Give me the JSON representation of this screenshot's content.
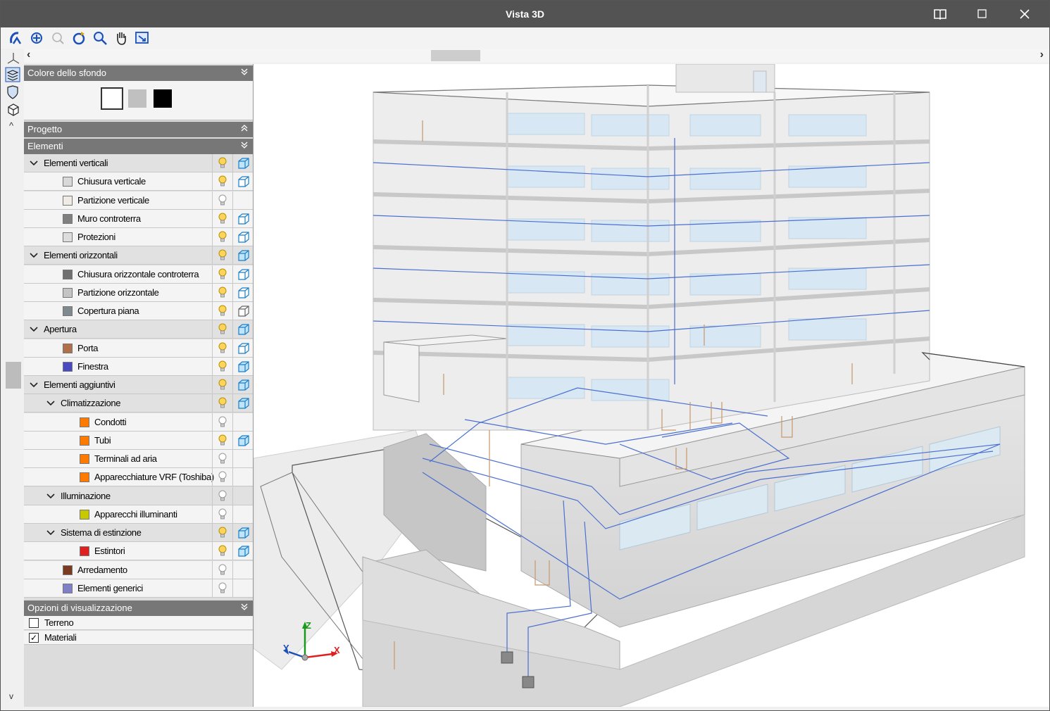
{
  "window": {
    "title": "Vista 3D",
    "book_icon": "book-icon",
    "maximize_icon": "maximize-icon",
    "close_icon": "close-icon"
  },
  "toolbar": {
    "icons": [
      "rotate-view-icon",
      "zoom-extents-icon",
      "zoom-previous-icon",
      "refresh-view-icon",
      "zoom-window-icon",
      "pan-hand-icon",
      "export-view-icon"
    ]
  },
  "scroll": {
    "left_arrow": "‹",
    "right_arrow": "›",
    "up_arrow": "^",
    "down_arrow": "v"
  },
  "background_panel": {
    "title": "Colore dello sfondo",
    "colors": [
      "#ffffff",
      "#c0c0c0",
      "#000000"
    ],
    "selected": 0
  },
  "project_panel": {
    "title": "Progetto"
  },
  "elements_panel": {
    "title": "Elementi",
    "rows": [
      {
        "label": "Elementi verticali",
        "level": 0,
        "group": true,
        "bulb": true,
        "cube": "solid"
      },
      {
        "label": "Chiusura verticale",
        "level": 1,
        "color": "#d9d9d9",
        "bulb": true,
        "cube": "wire"
      },
      {
        "label": "Partizione verticale",
        "level": 1,
        "color": "#f1ebe6",
        "bulb": false,
        "cube": "none"
      },
      {
        "label": "Muro controterra",
        "level": 1,
        "color": "#808080",
        "bulb": true,
        "cube": "wire"
      },
      {
        "label": "Protezioni",
        "level": 1,
        "color": "#dddddd",
        "bulb": true,
        "cube": "wire"
      },
      {
        "label": "Elementi orizzontali",
        "level": 0,
        "group": true,
        "bulb": true,
        "cube": "solid"
      },
      {
        "label": "Chiusura orizzontale controterra",
        "level": 1,
        "color": "#707070",
        "bulb": true,
        "cube": "wire"
      },
      {
        "label": "Partizione orizzontale",
        "level": 1,
        "color": "#c4c4c4",
        "bulb": true,
        "cube": "wire"
      },
      {
        "label": "Copertura piana",
        "level": 1,
        "color": "#808a8e",
        "bulb": true,
        "cube": "grey"
      },
      {
        "label": "Apertura",
        "level": 0,
        "group": true,
        "bulb": true,
        "cube": "solid"
      },
      {
        "label": "Porta",
        "level": 1,
        "color": "#b0704a",
        "bulb": true,
        "cube": "wire"
      },
      {
        "label": "Finestra",
        "level": 1,
        "color": "#4a4ac0",
        "bulb": true,
        "cube": "solid"
      },
      {
        "label": "Elementi aggiuntivi",
        "level": 0,
        "group": true,
        "bulb": true,
        "cube": "solid"
      },
      {
        "label": "Climatizzazione",
        "level": 1,
        "group": true,
        "bulb": true,
        "cube": "solid"
      },
      {
        "label": "Condotti",
        "level": 2,
        "color": "#ff7a00",
        "bulb": false,
        "cube": "none"
      },
      {
        "label": "Tubi",
        "level": 2,
        "color": "#ff7a00",
        "bulb": true,
        "cube": "solid"
      },
      {
        "label": "Terminali ad aria",
        "level": 2,
        "color": "#ff7a00",
        "bulb": false,
        "cube": "none"
      },
      {
        "label": "Apparecchiature VRF (Toshiba)",
        "level": 2,
        "color": "#ff7a00",
        "bulb": false,
        "cube": "none"
      },
      {
        "label": "Illuminazione",
        "level": 1,
        "group": true,
        "bulb": false,
        "cube": "none"
      },
      {
        "label": "Apparecchi illuminanti",
        "level": 2,
        "color": "#c8c800",
        "bulb": false,
        "cube": "none"
      },
      {
        "label": "Sistema di estinzione",
        "level": 1,
        "group": true,
        "bulb": true,
        "cube": "solid"
      },
      {
        "label": "Estintori",
        "level": 2,
        "color": "#e02020",
        "bulb": true,
        "cube": "solid"
      },
      {
        "label": "Arredamento",
        "level": 1,
        "color": "#7a3a20",
        "bulb": false,
        "cube": "none"
      },
      {
        "label": "Elementi generici",
        "level": 1,
        "color": "#8080c8",
        "bulb": false,
        "cube": "none"
      }
    ]
  },
  "display_options": {
    "title": "Opzioni di visualizzazione",
    "options": [
      {
        "label": "Terreno",
        "checked": false
      },
      {
        "label": "Materiali",
        "checked": true
      }
    ]
  },
  "axes": {
    "x": "X",
    "y": "Y",
    "z": "Z"
  },
  "colors": {
    "titlebar": "#535353",
    "section_header": "#777777",
    "duct_line": "#4a6fd0",
    "pipe_orange": "#c8966a"
  }
}
